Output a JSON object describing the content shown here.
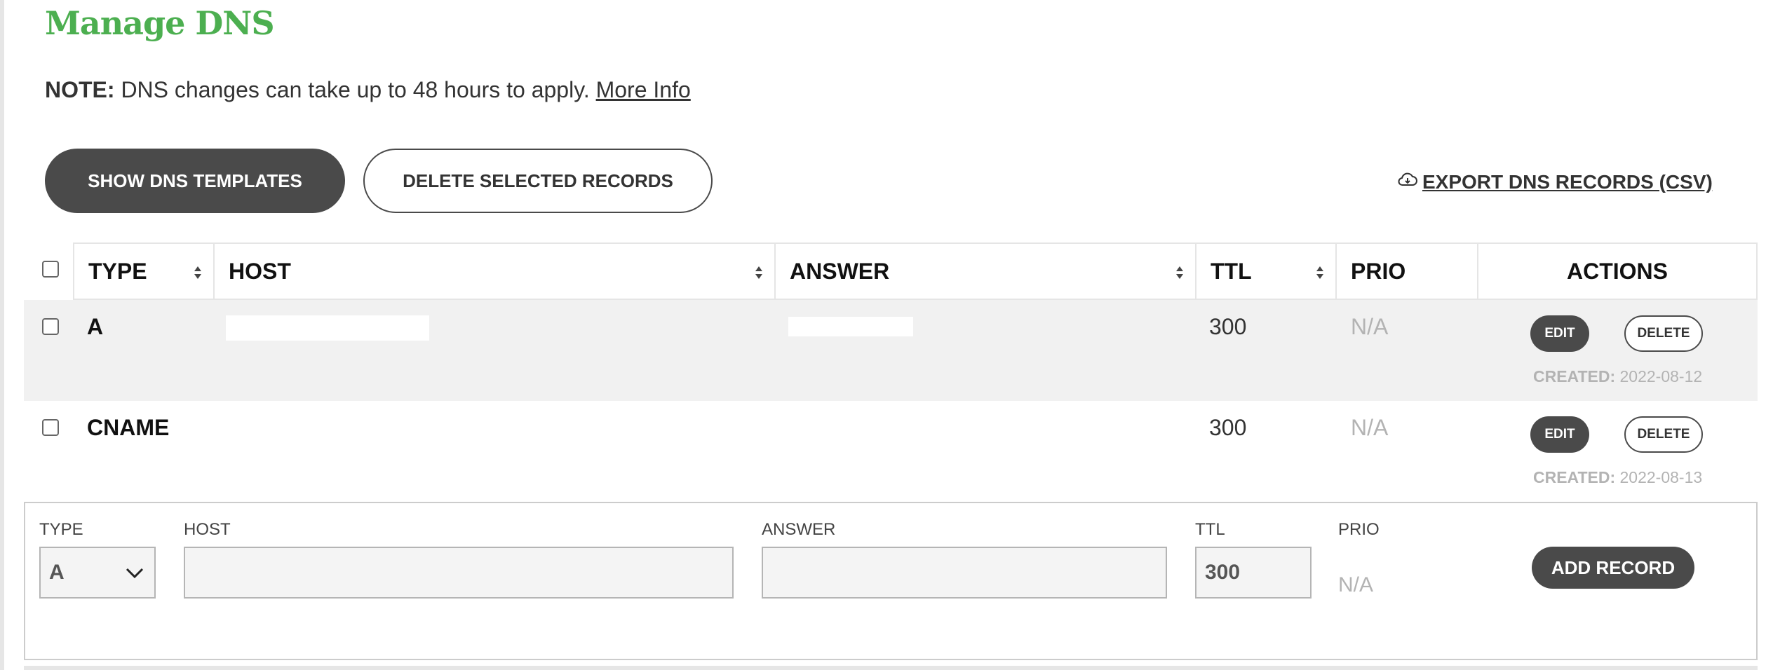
{
  "page": {
    "title": "Manage DNS"
  },
  "note": {
    "label": "NOTE:",
    "text": "DNS changes can take up to 48 hours to apply.",
    "link": "More Info"
  },
  "toolbar": {
    "show_templates": "SHOW DNS TEMPLATES",
    "delete_selected": "DELETE SELECTED RECORDS",
    "export": "EXPORT DNS RECORDS (CSV)"
  },
  "table": {
    "headers": {
      "type": "TYPE",
      "host": "HOST",
      "answer": "ANSWER",
      "ttl": "TTL",
      "prio": "PRIO",
      "actions": "ACTIONS"
    },
    "rows": [
      {
        "type": "A",
        "ttl": "300",
        "prio": "N/A",
        "edit": "EDIT",
        "delete": "DELETE",
        "created_label": "CREATED:",
        "created_date": "2022-08-12"
      },
      {
        "type": "CNAME",
        "ttl": "300",
        "prio": "N/A",
        "edit": "EDIT",
        "delete": "DELETE",
        "created_label": "CREATED:",
        "created_date": "2022-08-13"
      }
    ]
  },
  "add_form": {
    "type_label": "TYPE",
    "type_value": "A",
    "host_label": "HOST",
    "host_value": "",
    "answer_label": "ANSWER",
    "answer_value": "",
    "ttl_label": "TTL",
    "ttl_value": "300",
    "prio_label": "PRIO",
    "prio_value": "N/A",
    "add_button": "ADD RECORD"
  },
  "colors": {
    "brand_green": "#4caf50",
    "button_dark": "#4a4a4a",
    "muted": "#b3b3b3"
  }
}
